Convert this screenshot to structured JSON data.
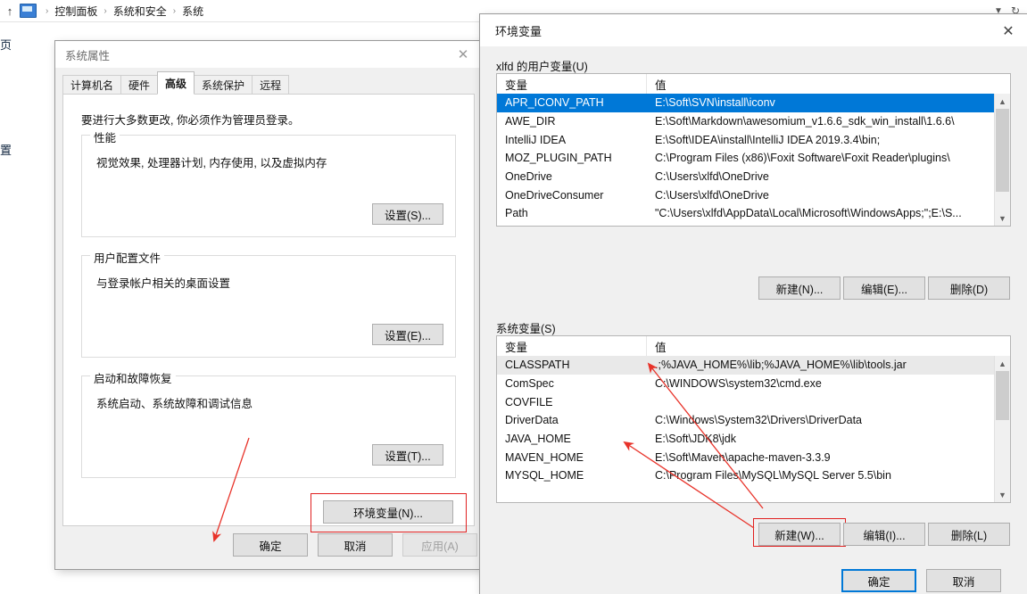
{
  "explorer": {
    "up_icon": "up-arrow-icon",
    "computer_icon": "computer-icon",
    "breadcrumbs": [
      "控制面板",
      "系统和安全",
      "系统"
    ],
    "separator": "›",
    "dropdown_icon": "chevron-down-icon",
    "refresh_icon": "refresh-icon",
    "side_text_top": "页",
    "side_text_bottom": "置"
  },
  "system_properties": {
    "title": "系统属性",
    "close_icon": "close-icon",
    "tabs": [
      {
        "label": "计算机名",
        "active": false
      },
      {
        "label": "硬件",
        "active": false
      },
      {
        "label": "高级",
        "active": true
      },
      {
        "label": "系统保护",
        "active": false
      },
      {
        "label": "远程",
        "active": false
      }
    ],
    "intro": "要进行大多数更改, 你必须作为管理员登录。",
    "groups": [
      {
        "legend": "性能",
        "text": "视觉效果, 处理器计划, 内存使用, 以及虚拟内存",
        "button": "设置(S)..."
      },
      {
        "legend": "用户配置文件",
        "text": "与登录帐户相关的桌面设置",
        "button": "设置(E)..."
      },
      {
        "legend": "启动和故障恢复",
        "text": "系统启动、系统故障和调试信息",
        "button": "设置(T)..."
      }
    ],
    "env_button": "环境变量(N)...",
    "footer": {
      "ok": "确定",
      "cancel": "取消",
      "apply": "应用(A)",
      "apply_disabled": true
    }
  },
  "environment_variables": {
    "title": "环境变量",
    "close_icon": "close-icon",
    "user_section": {
      "label": "xlfd 的用户变量(U)",
      "columns": [
        "变量",
        "值"
      ],
      "rows": [
        {
          "name": "APR_ICONV_PATH",
          "value": "E:\\Soft\\SVN\\install\\iconv",
          "selected": true
        },
        {
          "name": "AWE_DIR",
          "value": "E:\\Soft\\Markdown\\awesomium_v1.6.6_sdk_win_install\\1.6.6\\",
          "selected": false
        },
        {
          "name": "IntelliJ IDEA",
          "value": "E:\\Soft\\IDEA\\install\\IntelliJ IDEA 2019.3.4\\bin;",
          "selected": false
        },
        {
          "name": "MOZ_PLUGIN_PATH",
          "value": "C:\\Program Files (x86)\\Foxit Software\\Foxit Reader\\plugins\\",
          "selected": false
        },
        {
          "name": "OneDrive",
          "value": "C:\\Users\\xlfd\\OneDrive",
          "selected": false
        },
        {
          "name": "OneDriveConsumer",
          "value": "C:\\Users\\xlfd\\OneDrive",
          "selected": false
        },
        {
          "name": "Path",
          "value": "\"C:\\Users\\xlfd\\AppData\\Local\\Microsoft\\WindowsApps;\";E:\\S...",
          "selected": false
        }
      ],
      "buttons": {
        "new": "新建(N)...",
        "edit": "编辑(E)...",
        "delete": "删除(D)"
      }
    },
    "system_section": {
      "label": "系统变量(S)",
      "columns": [
        "变量",
        "值"
      ],
      "rows": [
        {
          "name": "CLASSPATH",
          "value": ".;%JAVA_HOME%\\lib;%JAVA_HOME%\\lib\\tools.jar",
          "highlighted": true
        },
        {
          "name": "ComSpec",
          "value": "C:\\WINDOWS\\system32\\cmd.exe",
          "highlighted": false
        },
        {
          "name": "COVFILE",
          "value": "",
          "highlighted": false
        },
        {
          "name": "DriverData",
          "value": "C:\\Windows\\System32\\Drivers\\DriverData",
          "highlighted": false
        },
        {
          "name": "JAVA_HOME",
          "value": "E:\\Soft\\JDK8\\jdk",
          "highlighted": false
        },
        {
          "name": "MAVEN_HOME",
          "value": "E:\\Soft\\Maven\\apache-maven-3.3.9",
          "highlighted": false
        },
        {
          "name": "MYSQL_HOME",
          "value": "C:\\Program Files\\MySQL\\MySQL Server 5.5\\bin",
          "highlighted": false
        }
      ],
      "buttons": {
        "new": "新建(W)...",
        "edit": "编辑(I)...",
        "delete": "删除(L)"
      }
    },
    "footer": {
      "ok": "确定",
      "cancel": "取消"
    }
  },
  "annotations": {
    "highlight_color": "#e02020",
    "focus_color": "#0078d7",
    "selection_color": "#0078d7"
  }
}
